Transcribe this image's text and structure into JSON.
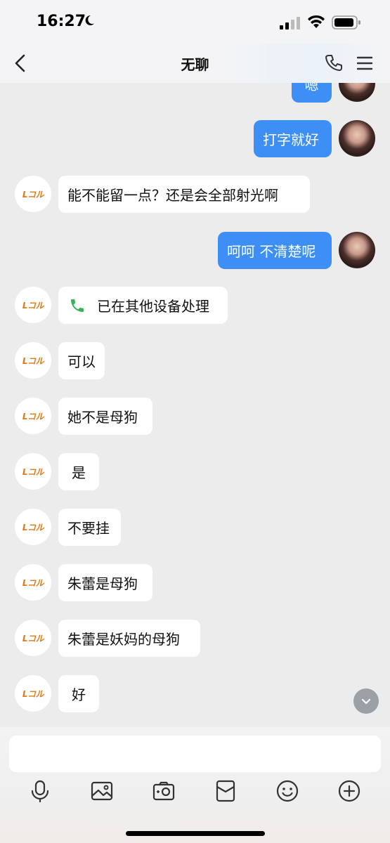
{
  "status": {
    "time": "16:27",
    "icons": [
      "moon-icon",
      "cellular-signal-icon",
      "wifi-icon",
      "battery-icon"
    ]
  },
  "header": {
    "title": "无聊",
    "icons": [
      "back-icon",
      "phone-icon",
      "menu-icon"
    ]
  },
  "messages": [
    {
      "side": "out",
      "text": "嗯"
    },
    {
      "side": "out",
      "text": "打字就好"
    },
    {
      "side": "in",
      "text": "能不能留一点？还是会全部射光啊"
    },
    {
      "side": "out",
      "text": "呵呵 不清楚呢"
    },
    {
      "side": "in",
      "text": "已在其他设备处理",
      "icon": "phone-icon"
    },
    {
      "side": "in",
      "text": "可以"
    },
    {
      "side": "in",
      "text": "她不是母狗"
    },
    {
      "side": "in",
      "text": "是"
    },
    {
      "side": "in",
      "text": "不要挂"
    },
    {
      "side": "in",
      "text": "朱蕾是母狗"
    },
    {
      "side": "in",
      "text": "朱蕾是妖妈的母狗"
    },
    {
      "side": "in",
      "text": "好"
    }
  ],
  "avatar_left_text": "Lコル",
  "input": {
    "placeholder": ""
  },
  "toolbar": [
    "microphone-icon",
    "image-icon",
    "camera-icon",
    "red-packet-icon",
    "emoji-icon",
    "plus-icon"
  ],
  "colors": {
    "accent": "#3d8ff5",
    "background": "#ececec",
    "call_green": "#3bb25a"
  }
}
